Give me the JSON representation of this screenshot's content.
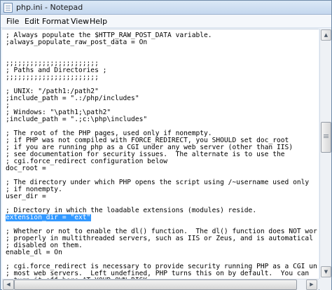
{
  "window": {
    "title": "php.ini - Notepad",
    "accent": "#3399ff"
  },
  "menu": {
    "items": [
      "File",
      "Edit",
      "Format",
      "View",
      "Help"
    ]
  },
  "editor": {
    "lines": [
      "; Always populate the $HTTP_RAW_POST_DATA variable.",
      ";always_populate_raw_post_data = On",
      "",
      "",
      ";;;;;;;;;;;;;;;;;;;;;;;",
      "; Paths and Directories ;",
      ";;;;;;;;;;;;;;;;;;;;;;;",
      "",
      "; UNIX: \"/path1:/path2\"",
      ";include_path = \".:/php/includes\"",
      ";",
      "; Windows: \"\\path1;\\path2\"",
      ";include_path = \".;c:\\php\\includes\"",
      "",
      "; The root of the PHP pages, used only if nonempty.",
      "; if PHP was not compiled with FORCE_REDIRECT, you SHOULD set doc_root",
      "; if you are running php as a CGI under any web server (other than IIS)",
      "; see documentation for security issues.  The alternate is to use the",
      "; cgi.force_redirect configuration below",
      "doc_root =",
      "",
      "; The directory under which PHP opens the script using /~username used only",
      "; if nonempty.",
      "user_dir =",
      "",
      "; Directory in which the loadable extensions (modules) reside.",
      "extension_dir = \"ext\"",
      "",
      "; Whether or not to enable the dl() function.  The dl() function does NOT wor",
      "; properly in multithreaded servers, such as IIS or Zeus, and is automatical",
      "; disabled on them.",
      "enable_dl = On",
      "",
      "; cgi.force_redirect is necessary to provide security running PHP as a CGI un",
      "; most web servers.  Left undefined, PHP turns this on by default.  You can",
      "; turn it off here AT YOUR OWN RISK"
    ],
    "selected_line_index": 26
  }
}
